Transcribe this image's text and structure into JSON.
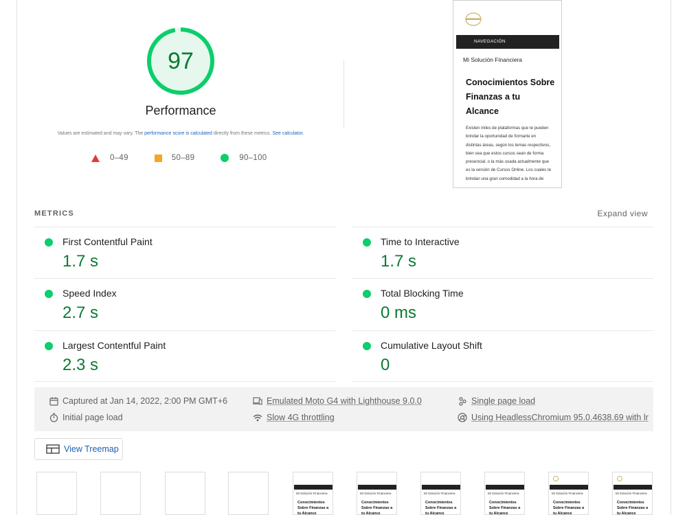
{
  "score": {
    "value": "97",
    "title": "Performance",
    "fraction": 0.97,
    "color": "#0cce6b"
  },
  "disclaimer": {
    "prefix": "Values are estimated and may vary. The ",
    "link1": "performance score is calculated",
    "middle": " directly from these metrics. ",
    "link2": "See calculator."
  },
  "legend": [
    {
      "shape": "triangle",
      "label": "0–49",
      "color": "#e53935"
    },
    {
      "shape": "square",
      "label": "50–89",
      "color": "#f6a623"
    },
    {
      "shape": "circle",
      "label": "90–100",
      "color": "#0cce6b"
    }
  ],
  "screenshot": {
    "nav": "NAVEGACIÓN",
    "site": "Mi Solución Financiera",
    "headline": "Conocimientos Sobre Finanzas a tu Alcance",
    "body": "Existen miles de plataformas que te pueden brindar la oportunidad de formarte en distintas áreas, según los temas respectivos, bien sea que estos cursos sean de forma presencial, o la más usada actualmente que es la versión de Cursos Online. Los cuales te brindan una gran comodidad a la hora de"
  },
  "metrics": {
    "title": "METRICS",
    "expand": "Expand view",
    "items": [
      {
        "label": "First Contentful Paint",
        "value": "1.7 s"
      },
      {
        "label": "Time to Interactive",
        "value": "1.7 s"
      },
      {
        "label": "Speed Index",
        "value": "2.7 s"
      },
      {
        "label": "Total Blocking Time",
        "value": "0 ms"
      },
      {
        "label": "Largest Contentful Paint",
        "value": "2.3 s"
      },
      {
        "label": "Cumulative Layout Shift",
        "value": "0"
      }
    ]
  },
  "info": {
    "captured": "Captured at Jan 14, 2022, 2:00 PM GMT+6",
    "initial": "Initial page load",
    "device": "Emulated Moto G4 with Lighthouse 9.0.0",
    "throttling": "Slow 4G throttling",
    "single": "Single page load",
    "browser": "Using HeadlessChromium 95.0.4638.69 with lr"
  },
  "treemap": {
    "label": "View Treemap"
  },
  "filmstrip": {
    "site": "Mi Solución Financiera",
    "headline": "Conocimientos Sobre Finanzas a tu Alcance"
  }
}
